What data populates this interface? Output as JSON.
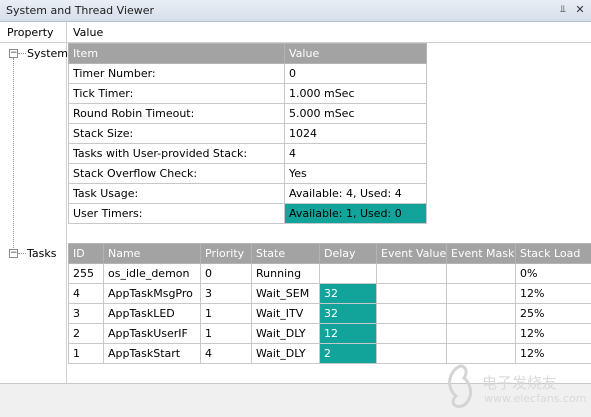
{
  "window": {
    "title": "System and Thread Viewer",
    "pin_icon": "pin-icon",
    "close_icon": "close-icon"
  },
  "columns": {
    "property": "Property",
    "value": "Value"
  },
  "tree": {
    "system_label": "System",
    "tasks_label": "Tasks"
  },
  "system_table": {
    "headers": [
      "Item",
      "Value"
    ],
    "rows": [
      [
        "Timer Number:",
        "0"
      ],
      [
        "Tick Timer:",
        "1.000 mSec"
      ],
      [
        "Round Robin Timeout:",
        "5.000 mSec"
      ],
      [
        "Stack Size:",
        "1024"
      ],
      [
        "Tasks with User-provided Stack:",
        "4"
      ],
      [
        "Stack Overflow Check:",
        "Yes"
      ],
      [
        "Task Usage:",
        "Available: 4, Used: 4"
      ],
      [
        "User Timers:",
        "Available: 1, Used: 0"
      ]
    ]
  },
  "task_table": {
    "headers": [
      "ID",
      "Name",
      "Priority",
      "State",
      "Delay",
      "Event Value",
      "Event Mask",
      "Stack Load"
    ],
    "rows": [
      [
        "255",
        "os_idle_demon",
        "0",
        "Running",
        "",
        "",
        "",
        "0%"
      ],
      [
        "4",
        "AppTaskMsgPro",
        "3",
        "Wait_SEM",
        "32",
        "",
        "",
        "12%"
      ],
      [
        "3",
        "AppTaskLED",
        "1",
        "Wait_ITV",
        "32",
        "",
        "",
        "25%"
      ],
      [
        "2",
        "AppTaskUserIF",
        "1",
        "Wait_DLY",
        "12",
        "",
        "",
        "12%"
      ],
      [
        "1",
        "AppTaskStart",
        "4",
        "Wait_DLY",
        "2",
        "",
        "",
        "12%"
      ]
    ]
  },
  "colors": {
    "highlight": "#12a39a",
    "header_bg": "#a3a3a3"
  },
  "watermark": {
    "text": "电子发烧友",
    "url": "www.elecfans.com"
  }
}
